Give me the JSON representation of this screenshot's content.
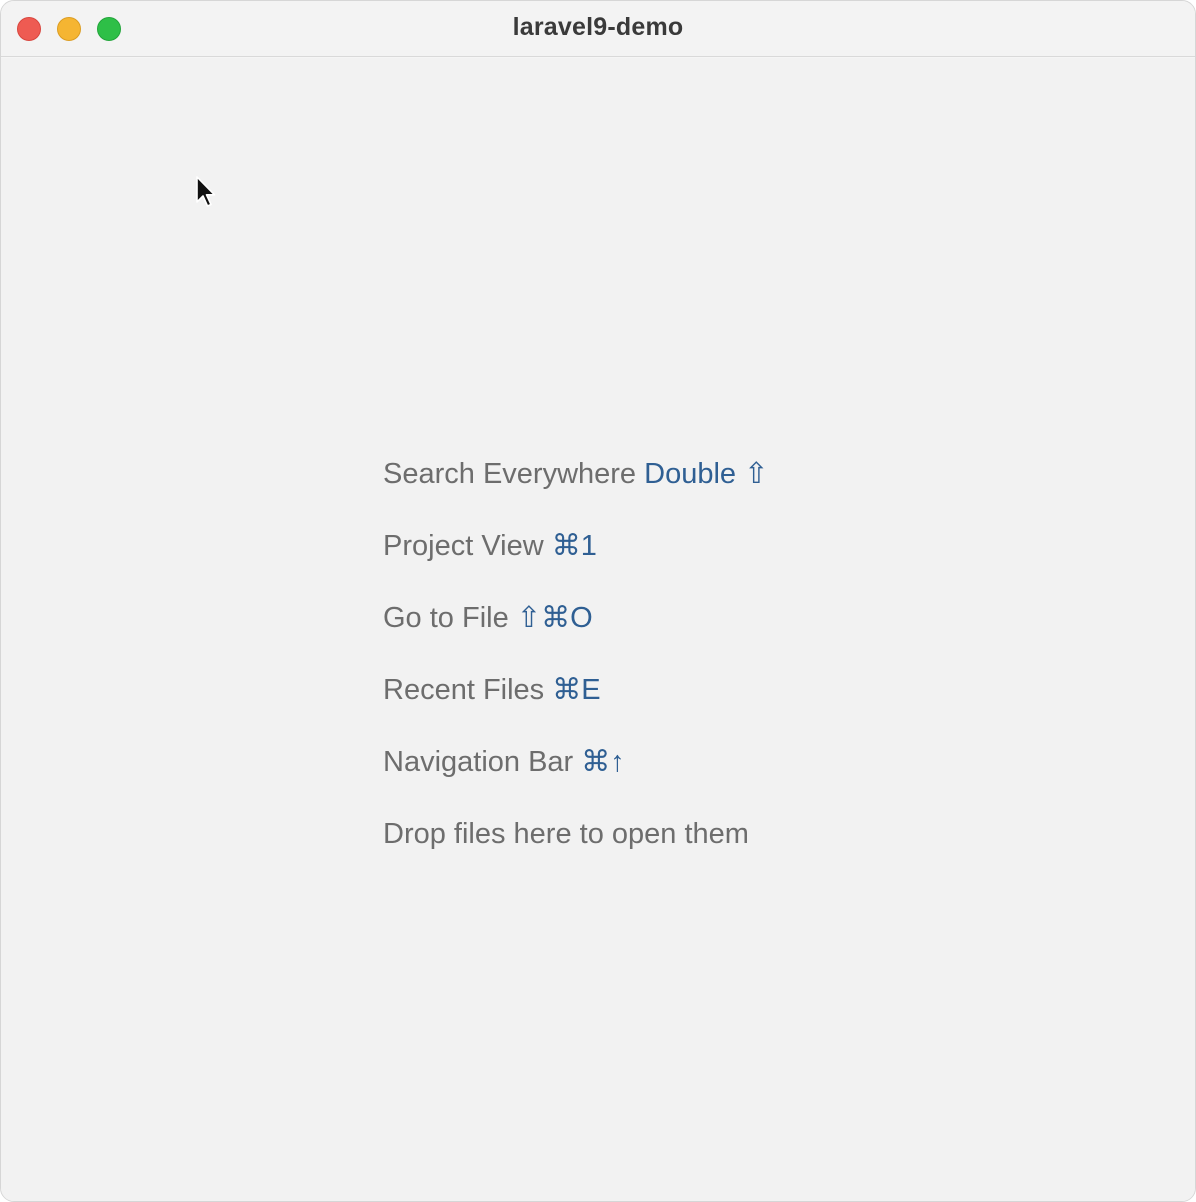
{
  "window": {
    "title": "laravel9-demo"
  },
  "traffic_lights": {
    "close": "#ee5b52",
    "minimize": "#f5b532",
    "zoom": "#2ebf47"
  },
  "hints": [
    {
      "label": "Search Everywhere",
      "shortcut": "Double ⇧"
    },
    {
      "label": "Project View",
      "shortcut": "⌘1"
    },
    {
      "label": "Go to File",
      "shortcut": "⇧⌘O"
    },
    {
      "label": "Recent Files",
      "shortcut": "⌘E"
    },
    {
      "label": "Navigation Bar",
      "shortcut": "⌘↑"
    },
    {
      "label": "Drop files here to open them",
      "shortcut": ""
    }
  ],
  "colors": {
    "hint_text": "#6d6d6d",
    "shortcut_text": "#2f5f93",
    "background": "#f2f2f2"
  },
  "pointer": {
    "icon": "mouse-pointer-icon"
  }
}
